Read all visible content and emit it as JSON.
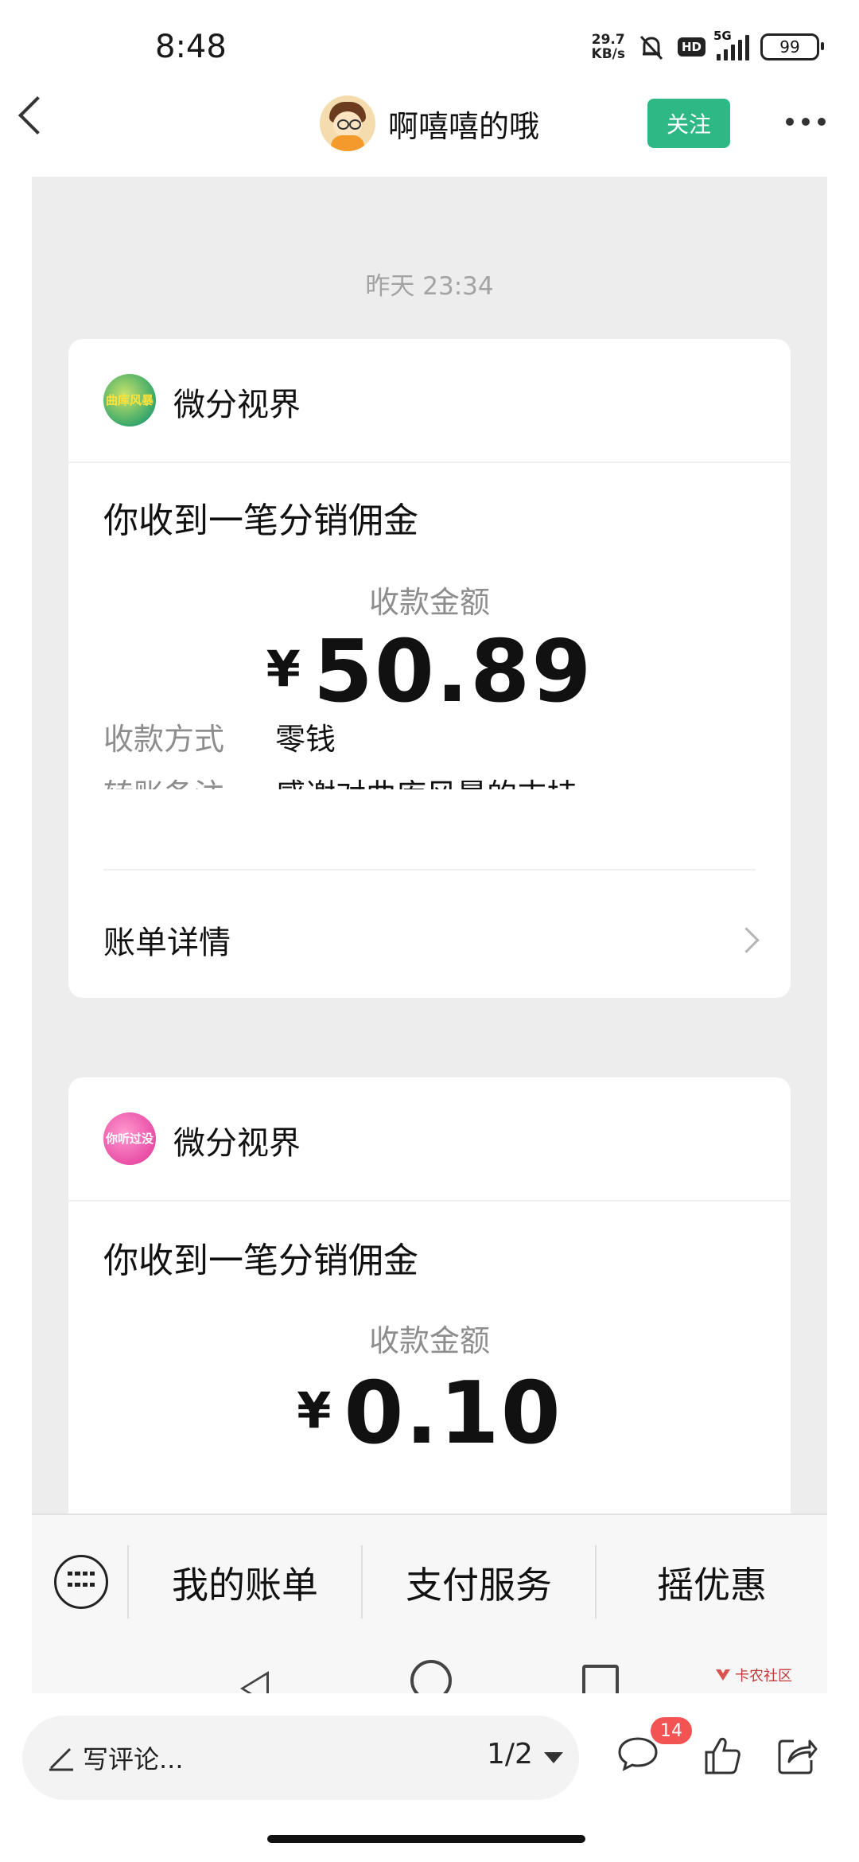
{
  "status_bar": {
    "time": "8:48",
    "net_speed_value": "29.7",
    "net_speed_unit": "KB/s",
    "hd_label": "HD",
    "network_type": "5G",
    "battery": "99"
  },
  "header": {
    "nickname": "啊嘻嘻的哦",
    "follow_label": "关注"
  },
  "chat": {
    "timestamp": "昨天 23:34",
    "cards": [
      {
        "shop_name": "微分视界",
        "logo_text": "曲库风暴",
        "title": "你收到一笔分销佣金",
        "amount_label": "收款金额",
        "currency": "¥",
        "amount": "50.89",
        "method_label": "收款方式",
        "method_value": "零钱",
        "remark_label": "转账备注",
        "remark_value": "感谢对曲库风暴的支持",
        "detail_label": "账单详情"
      },
      {
        "shop_name": "微分视界",
        "logo_text": "你听过没",
        "title": "你收到一笔分销佣金",
        "amount_label": "收款金额",
        "currency": "¥",
        "amount": "0.10"
      }
    ]
  },
  "menu": {
    "items": [
      "我的账单",
      "支付服务",
      "摇优惠"
    ]
  },
  "watermark": "卡农社区",
  "bottom_bar": {
    "comment_placeholder": "写评论...",
    "pager": "1/2",
    "comment_count": "14"
  }
}
